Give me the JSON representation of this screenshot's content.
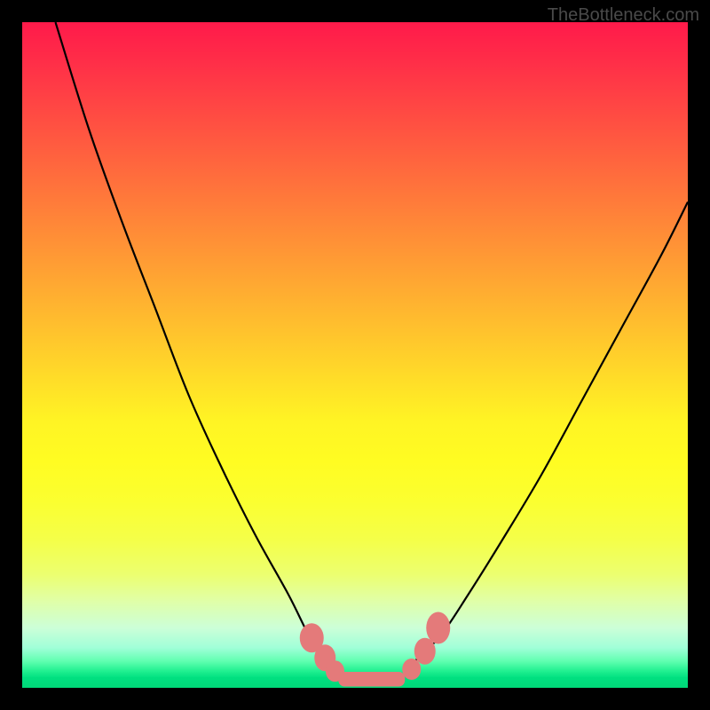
{
  "watermark": "TheBottleneck.com",
  "chart_data": {
    "type": "line",
    "title": "",
    "xlabel": "",
    "ylabel": "",
    "xlim": [
      0,
      100
    ],
    "ylim": [
      0,
      100
    ],
    "series": [
      {
        "name": "curve-left",
        "x": [
          5,
          10,
          15,
          20,
          25,
          30,
          35,
          40,
          43,
          45,
          47
        ],
        "y": [
          100,
          84,
          70,
          57,
          44,
          33,
          23,
          14,
          8,
          5,
          3
        ]
      },
      {
        "name": "curve-right",
        "x": [
          58,
          60,
          63,
          67,
          72,
          78,
          84,
          90,
          96,
          100
        ],
        "y": [
          3,
          5,
          8,
          14,
          22,
          32,
          43,
          54,
          65,
          73
        ]
      }
    ],
    "markers": [
      {
        "name": "left-dot-1",
        "x": 43.5,
        "y": 7.5,
        "rx": 1.8,
        "ry": 2.2
      },
      {
        "name": "left-dot-2",
        "x": 45.5,
        "y": 4.5,
        "rx": 1.6,
        "ry": 2.0
      },
      {
        "name": "left-dot-3",
        "x": 47.0,
        "y": 2.5,
        "rx": 1.4,
        "ry": 1.6
      },
      {
        "name": "right-dot-1",
        "x": 58.5,
        "y": 2.8,
        "rx": 1.4,
        "ry": 1.6
      },
      {
        "name": "right-dot-2",
        "x": 60.5,
        "y": 5.5,
        "rx": 1.6,
        "ry": 2.0
      },
      {
        "name": "right-dot-3",
        "x": 62.5,
        "y": 9.0,
        "rx": 1.8,
        "ry": 2.4
      }
    ],
    "bottom_bar": {
      "x_start": 47.5,
      "x_end": 57.5,
      "y": 1.3,
      "height": 2.2
    },
    "gradient_desc": "vertical rainbow gradient from red (top) through orange, yellow to green (bottom)",
    "accent_color": "#e47a7a",
    "curve_color": "#000000"
  }
}
